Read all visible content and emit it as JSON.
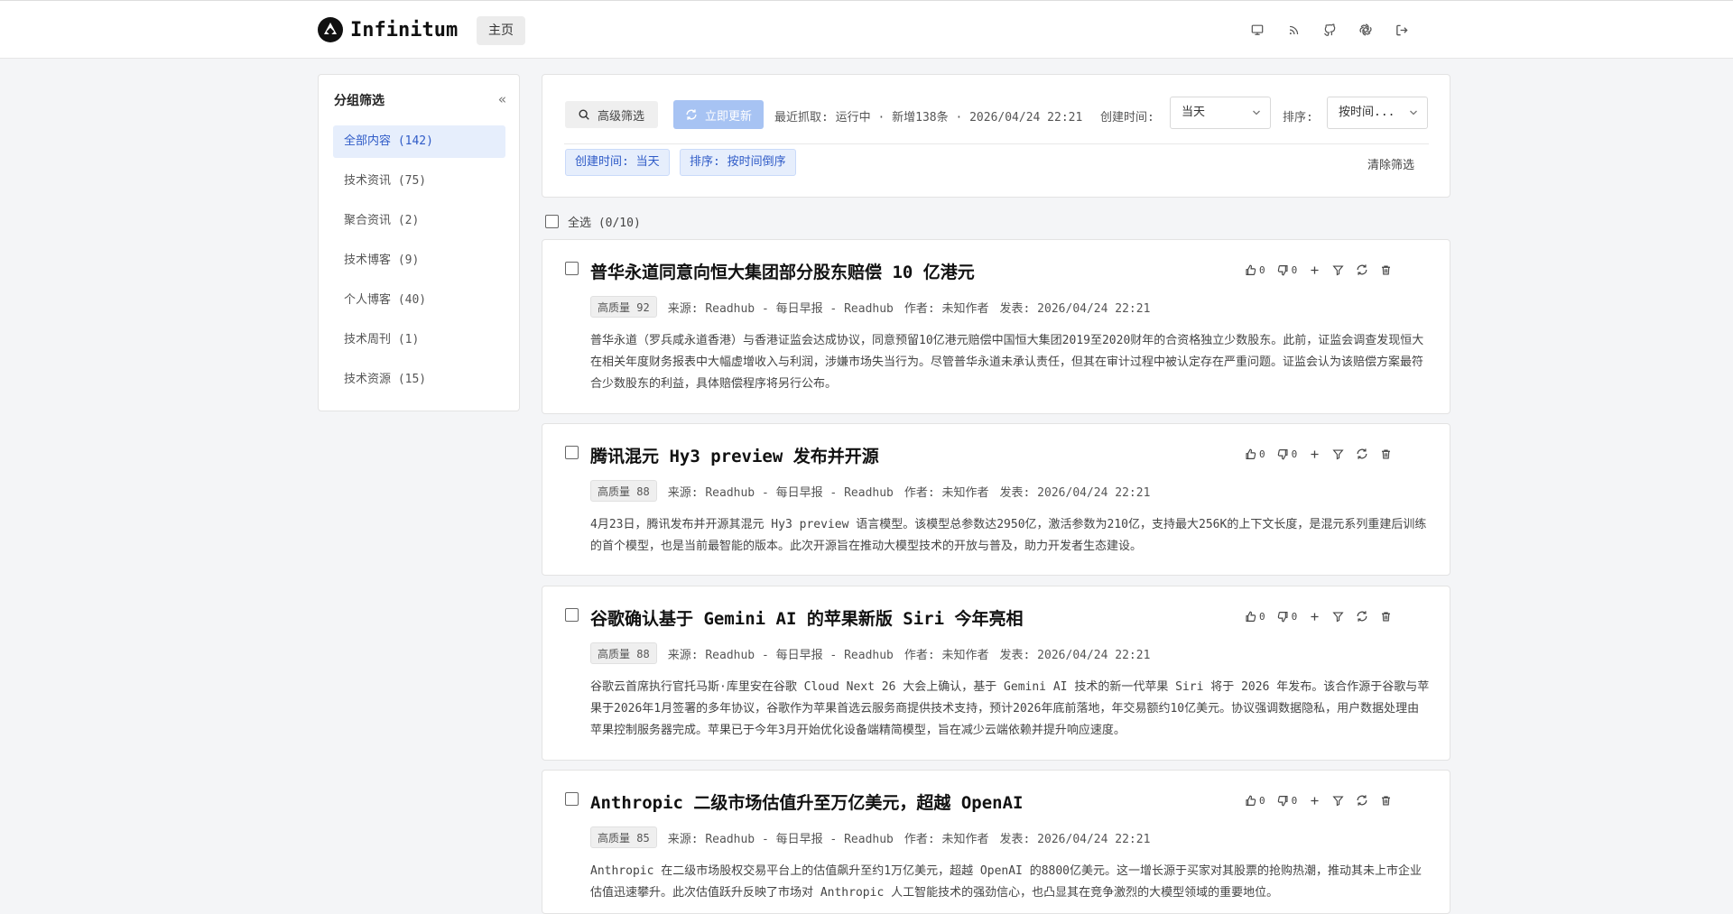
{
  "app": {
    "name": "Infinitum",
    "home_tab": "主页"
  },
  "header_icons": [
    "monitor-icon",
    "rss-icon",
    "github-icon",
    "openai-icon",
    "logout-icon"
  ],
  "sidebar": {
    "title": "分组筛选",
    "collapse": "«",
    "items": [
      {
        "label": "全部内容 (142)",
        "active": true
      },
      {
        "label": "技术资讯 (75)"
      },
      {
        "label": "聚合资讯 (2)"
      },
      {
        "label": "技术博客 (9)"
      },
      {
        "label": "个人博客 (40)"
      },
      {
        "label": "技术周刊 (1)"
      },
      {
        "label": "技术资源 (15)"
      }
    ]
  },
  "filter": {
    "advanced": "高级筛选",
    "refresh": "立即更新",
    "status": "最近抓取: 运行中 · 新增138条 · 2026/04/24 22:21",
    "created_label": "创建时间:",
    "created_value": "当天",
    "sort_label": "排序:",
    "sort_value": "按时间...",
    "chips": [
      "创建时间: 当天",
      "排序: 按时间倒序"
    ],
    "clear": "清除筛选"
  },
  "select_all": "全选 (0/10)",
  "articles": [
    {
      "title": "普华永道同意向恒大集团部分股东赔偿 10 亿港元",
      "likes": "0",
      "dislikes": "0",
      "quality": "高质量 92",
      "source": "来源: Readhub - 每日早报 - Readhub",
      "author": "作者: 未知作者",
      "published": "发表: 2026/04/24 22:21",
      "summary": "普华永道（罗兵咸永道香港）与香港证监会达成协议，同意预留10亿港元赔偿中国恒大集团2019至2020财年的合资格独立少数股东。此前，证监会调查发现恒大在相关年度财务报表中大幅虚增收入与利润，涉嫌市场失当行为。尽管普华永道未承认责任，但其在审计过程中被认定存在严重问题。证监会认为该赔偿方案最符合少数股东的利益，具体赔偿程序将另行公布。"
    },
    {
      "title": "腾讯混元 Hy3 preview 发布并开源",
      "likes": "0",
      "dislikes": "0",
      "quality": "高质量 88",
      "source": "来源: Readhub - 每日早报 - Readhub",
      "author": "作者: 未知作者",
      "published": "发表: 2026/04/24 22:21",
      "summary": "4月23日，腾讯发布并开源其混元 Hy3 preview 语言模型。该模型总参数达2950亿，激活参数为210亿，支持最大256K的上下文长度，是混元系列重建后训练的首个模型，也是当前最智能的版本。此次开源旨在推动大模型技术的开放与普及，助力开发者生态建设。"
    },
    {
      "title": "谷歌确认基于 Gemini AI 的苹果新版 Siri 今年亮相",
      "likes": "0",
      "dislikes": "0",
      "quality": "高质量 88",
      "source": "来源: Readhub - 每日早报 - Readhub",
      "author": "作者: 未知作者",
      "published": "发表: 2026/04/24 22:21",
      "summary": "谷歌云首席执行官托马斯·库里安在谷歌 Cloud Next 26 大会上确认，基于 Gemini AI 技术的新一代苹果 Siri 将于 2026 年发布。该合作源于谷歌与苹果于2026年1月签署的多年协议，谷歌作为苹果首选云服务商提供技术支持，预计2026年底前落地，年交易额约10亿美元。协议强调数据隐私，用户数据处理由苹果控制服务器完成。苹果已于今年3月开始优化设备端精简模型，旨在减少云端依赖并提升响应速度。"
    },
    {
      "title": "Anthropic 二级市场估值升至万亿美元，超越 OpenAI",
      "likes": "0",
      "dislikes": "0",
      "quality": "高质量 85",
      "source": "来源: Readhub - 每日早报 - Readhub",
      "author": "作者: 未知作者",
      "published": "发表: 2026/04/24 22:21",
      "summary": "Anthropic 在二级市场股权交易平台上的估值飙升至约1万亿美元，超越 OpenAI 的8800亿美元。这一增长源于买家对其股票的抢购热潮，推动其未上市企业估值迅速攀升。此次估值跃升反映了市场对 Anthropic 人工智能技术的强劲信心，也凸显其在竞争激烈的大模型领域的重要地位。"
    }
  ]
}
